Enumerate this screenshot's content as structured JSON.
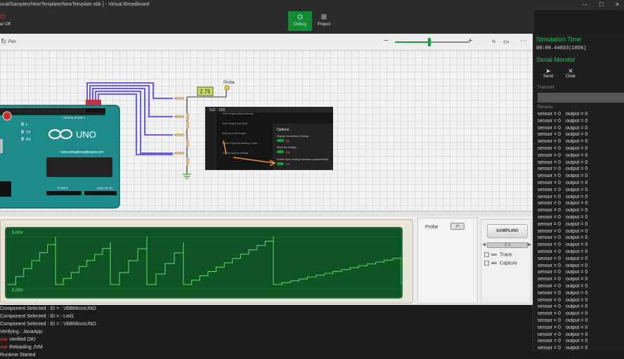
{
  "window": {
    "title": "ocal/Samples/NewTemplate/NewTemplate.vbb ] - Virtual Breadboard",
    "controls": [
      "—",
      "☐",
      "✕"
    ]
  },
  "ribbon": {
    "power_label": "er Off",
    "debug_label": "Debug",
    "project_label": "Project"
  },
  "toolbar": {
    "pan_label": "Pan",
    "zoom_fraction": 0.46,
    "percent_label": "%"
  },
  "circuit": {
    "probe_label": "Probe",
    "meter_value": "2.76",
    "board_brand": "UNO",
    "board_site": "www.virtualbreadboard.com",
    "analog_label": "ANALOG IN",
    "power_label": "POWER",
    "digital_label": "DIGITAL (PWM~)",
    "leds": [
      "L",
      "TX",
      "RX"
    ],
    "popup": {
      "tabs": [
        "012",
        "002"
      ],
      "menu": [
        "Clone Project without Saving",
        "Save Project and Close",
        "Save As Local Project",
        "Export Project to Desktop Folder",
        "VSTVM options settings"
      ],
      "options_title": "Options",
      "options": [
        {
          "label": "Display Connections Overlay",
          "state": "On"
        },
        {
          "label": "Show Pin Tooltips",
          "state": "On"
        },
        {
          "label": "Enable Spice Analog Evaluation (experimental)",
          "state": "On"
        }
      ]
    }
  },
  "scope": {
    "top_voltage": "5.00V",
    "bottom_voltage": "0.00V"
  },
  "probe_panel": {
    "label": "Probe"
  },
  "sampling": {
    "button_label": "SAMPLING",
    "rate": "2 s",
    "trace_label": "Trace",
    "capture_label": "Capture"
  },
  "log": [
    {
      "text": "Component Selected : ID = : VBBMicroUNO"
    },
    {
      "text": "Component Selected : ID = : Led1"
    },
    {
      "text": "Component Selected : ID = : VBBMicroUNO"
    },
    {
      "text": "Verifying : JavaApp:"
    },
    {
      "tag": "JVM",
      "text": "Verified OK!"
    },
    {
      "tag": "JVM",
      "text": "Reloading JVM"
    },
    {
      "text": "Runtime Started"
    }
  ],
  "right_panel": {
    "sim_time_title": "Simulation Time",
    "sim_time_value": "00:09.44833(105%)",
    "serial_title": "Serial Monitor",
    "send_label": "Send",
    "clear_label": "Clear",
    "transmit_label": "Transmit",
    "receive_label": "Receive",
    "serial_rows": [
      {
        "sensor": "sensor = 0",
        "output": "output = 0"
      },
      {
        "sensor": "sensor = 0",
        "output": "output = 0"
      },
      {
        "sensor": "sensor = 0",
        "output": "output = 0"
      },
      {
        "sensor": "sensor = 0",
        "output": "output = 0"
      },
      {
        "sensor": "sensor = 0",
        "output": "output = 0"
      },
      {
        "sensor": "sensor = 0",
        "output": "output = 0"
      },
      {
        "sensor": "sensor = 0",
        "output": "output = 0"
      },
      {
        "sensor": "sensor = 0",
        "output": "output = 0"
      },
      {
        "sensor": "sensor = 0",
        "output": "output = 0"
      },
      {
        "sensor": "sensor = 0",
        "output": "output = 0"
      },
      {
        "sensor": "sensor = 0",
        "output": "output = 0"
      },
      {
        "sensor": "sensor = 0",
        "output": "output = 0"
      },
      {
        "sensor": "sensor = 0",
        "output": "output = 0"
      },
      {
        "sensor": "sensor = 0",
        "output": "output = 0"
      },
      {
        "sensor": "sensor = 0",
        "output": "output = 0"
      },
      {
        "sensor": "sensor = 0",
        "output": "output = 0"
      },
      {
        "sensor": "sensor = 0",
        "output": "output = 0"
      },
      {
        "sensor": "sensor = 0",
        "output": "output = 0"
      },
      {
        "sensor": "sensor = 0",
        "output": "output = 0"
      },
      {
        "sensor": "sensor = 0",
        "output": "output = 0"
      },
      {
        "sensor": "sensor = 0",
        "output": "output = 0"
      },
      {
        "sensor": "sensor = 0",
        "output": "output = 0"
      },
      {
        "sensor": "sensor = 0",
        "output": "output = 0"
      },
      {
        "sensor": "sensor = 0",
        "output": "output = 0"
      },
      {
        "sensor": "sensor = 0",
        "output": "output = 0"
      },
      {
        "sensor": "sensor = 0",
        "output": "output = 0"
      },
      {
        "sensor": "sensor = 0",
        "output": "output = 0"
      },
      {
        "sensor": "sensor = 0",
        "output": "output = 0"
      },
      {
        "sensor": "sensor = 0",
        "output": "output = 0"
      },
      {
        "sensor": "sensor = 0",
        "output": "output = 0"
      },
      {
        "sensor": "sensor = 0",
        "output": "output = 0"
      },
      {
        "sensor": "sensor = 0",
        "output": "output = 0"
      },
      {
        "sensor": "sensor = 0",
        "output": "output = 0"
      },
      {
        "sensor": "sensor = 0",
        "output": "output = 0"
      },
      {
        "sensor": "sensor = 0",
        "output": "output = 0"
      }
    ]
  },
  "colors": {
    "accent": "#138a36",
    "scope_trace": "#5fe06e",
    "board": "#1f8a8a",
    "wire": "#6a5cf0"
  }
}
